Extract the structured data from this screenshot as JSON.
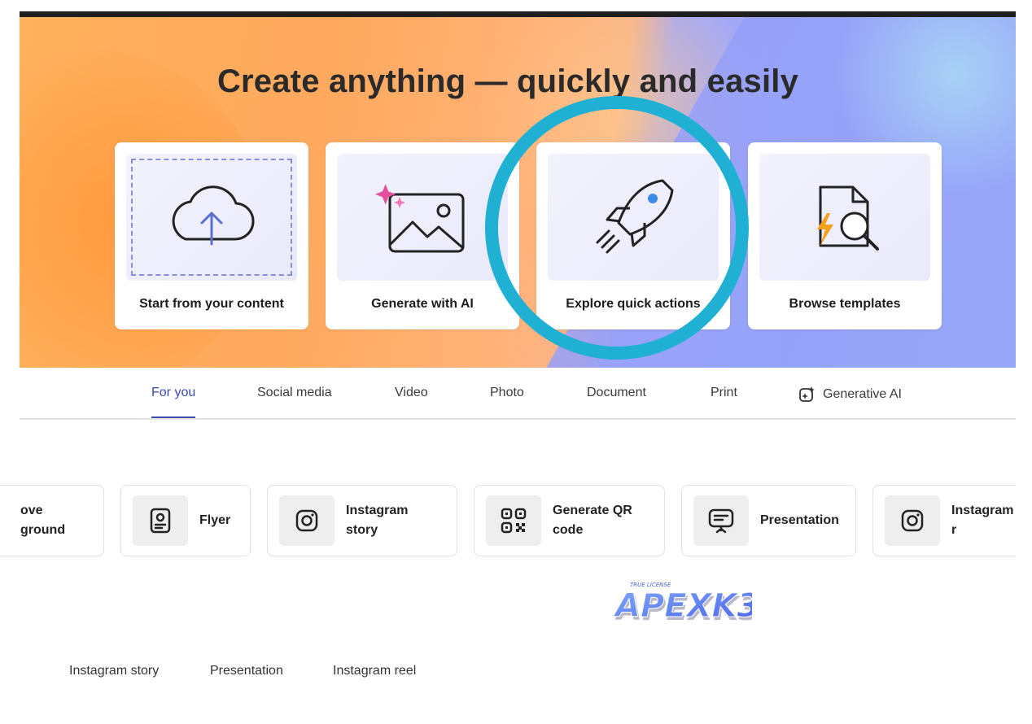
{
  "hero": {
    "title": "Create anything — quickly and easily"
  },
  "cards": [
    {
      "label": "Start from your content",
      "icon": "cloud-upload-icon"
    },
    {
      "label": "Generate with AI",
      "icon": "ai-image-icon"
    },
    {
      "label": "Explore quick actions",
      "icon": "rocket-icon"
    },
    {
      "label": "Browse templates",
      "icon": "template-search-icon"
    }
  ],
  "tabs": [
    {
      "label": "For you",
      "active": true
    },
    {
      "label": "Social media"
    },
    {
      "label": "Video"
    },
    {
      "label": "Photo"
    },
    {
      "label": "Document"
    },
    {
      "label": "Print"
    },
    {
      "label": "Generative AI",
      "icon": "sparkle-icon"
    }
  ],
  "quick_actions": [
    {
      "label": "ove\nground",
      "icon": "none"
    },
    {
      "label": "Flyer",
      "icon": "flyer-icon"
    },
    {
      "label": "Instagram\nstory",
      "icon": "instagram-icon"
    },
    {
      "label": "Generate QR\ncode",
      "icon": "qr-code-icon"
    },
    {
      "label": "Presentation",
      "icon": "presentation-icon"
    },
    {
      "label": "Instagram r",
      "icon": "instagram-icon"
    }
  ],
  "watermark": {
    "small": "TRUE LICENSE",
    "brand": "APEXK3"
  },
  "bottom_links": [
    {
      "label": "Instagram story"
    },
    {
      "label": "Presentation"
    },
    {
      "label": "Instagram reel"
    }
  ],
  "colors": {
    "highlight_ring": "#1fb0d4",
    "active_tab": "#3b4bb0"
  }
}
